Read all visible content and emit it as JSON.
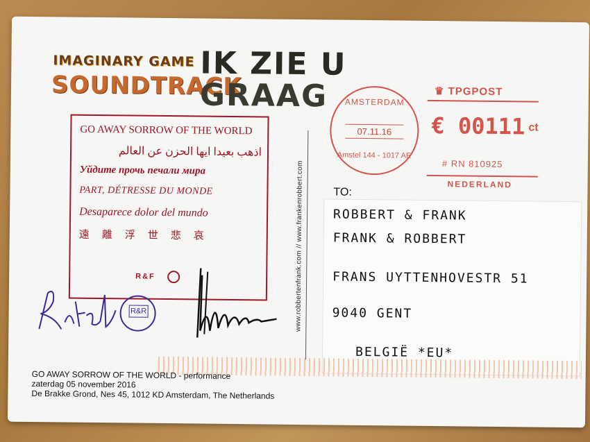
{
  "postcard": {
    "imaginary_line1": "IMAGINARY GAME",
    "imaginary_line2": "SOUNDTRACK",
    "headline_line1": "IK ZIE U",
    "headline_line2": "GRAAG",
    "message_lines": [
      "GO AWAY SORROW OF THE WORLD",
      "اذهب بعيدا ايها الحزن عن العالم",
      "Уйдите прочь печали мира",
      "PART, DÉTRESSE DU MONDE",
      "Desaparece dolor del mundo",
      "遠離浮世悲哀"
    ],
    "logo_text": "R&F",
    "stamp_text": "R&R",
    "vertical_url": "www.robbertenfrank.com // www.frankenrobbert.com",
    "postmark": {
      "city": "AMSTERDAM",
      "date": "07.11.16",
      "address": "Amstel 144 - 1017 AE"
    },
    "franking": {
      "brand": "TPGPOST",
      "amount": "€ 00111",
      "unit": "ct",
      "rn": "# RN 810925",
      "country": "NEDERLAND"
    },
    "to_label": "TO:",
    "address_lines": [
      "ROBBERT & FRANK",
      "FRANK & ROBBERT",
      "FRANS UYTTENHOVESTR 51",
      "9040 GENT",
      "BELGIË *EU*"
    ],
    "footer_lines": [
      "GO AWAY SORROW OF THE WORLD - performance",
      "zaterdag 05 november 2016",
      "De Brakke Grond, Nes 45, 1012 KD Amsterdam, The Netherlands"
    ],
    "signature_left": "Robbert",
    "colors": {
      "card": "#f6f6f4",
      "stamp_red": "#d2544a",
      "message_red": "#9b1626",
      "ink_blue": "#3c2a9a"
    }
  }
}
